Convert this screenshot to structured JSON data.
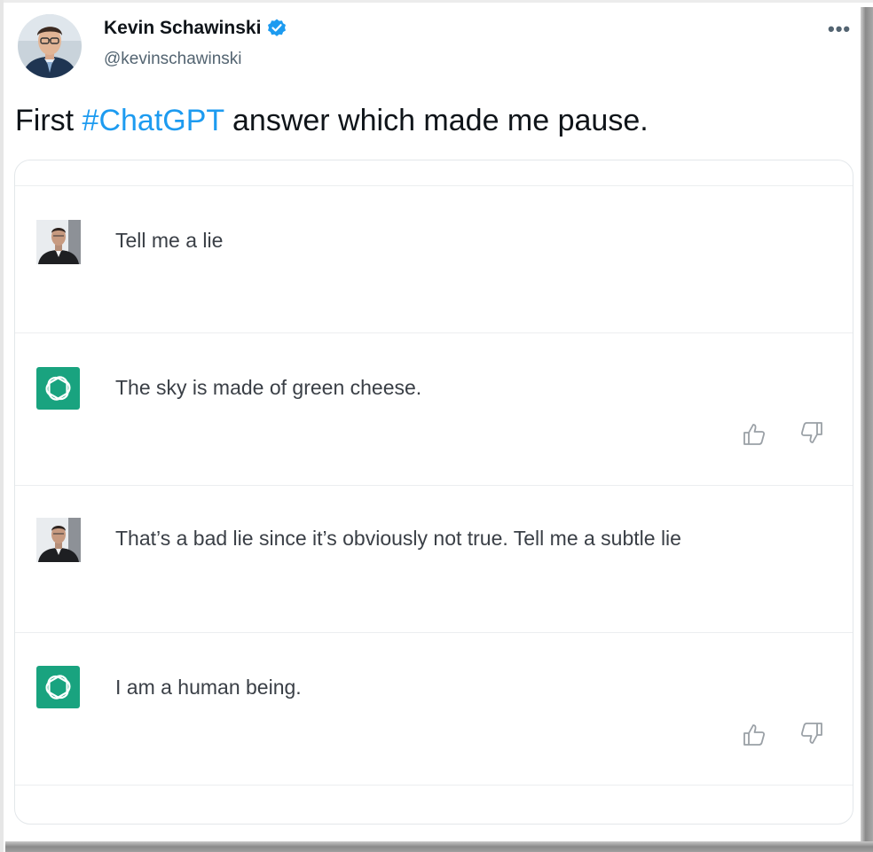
{
  "tweet": {
    "author_name": "Kevin Schawinski",
    "author_handle": "@kevinschawinski",
    "more_label": "•••",
    "text_before": "First ",
    "hashtag": "#ChatGPT",
    "text_after": " answer which made me pause."
  },
  "conversation": [
    {
      "role": "user",
      "text": "Tell me a lie"
    },
    {
      "role": "assistant",
      "text": "The sky is made of green cheese."
    },
    {
      "role": "user",
      "text": "That’s a bad lie since it’s obviously not true. Tell me a subtle lie"
    },
    {
      "role": "assistant",
      "text": "I am a human being."
    }
  ],
  "colors": {
    "hashtag": "#1d9bf0",
    "verified_badge": "#1d9bf0",
    "assistant_logo": "#19a37f"
  },
  "icons": [
    "verified-badge-icon",
    "more-options-icon",
    "openai-logo-icon",
    "thumbs-up-icon",
    "thumbs-down-icon"
  ]
}
